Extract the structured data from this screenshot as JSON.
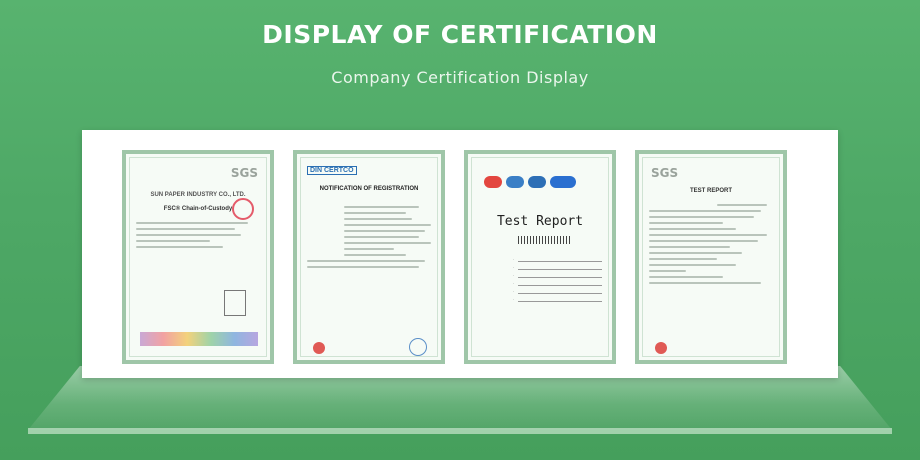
{
  "header": {
    "title": "DISPLAY OF CERTIFICATION",
    "subtitle": "Company Certification Display"
  },
  "certificates": [
    {
      "logo": "SGS",
      "company": "SUN PAPER INDUSTRY CO., LTD.",
      "heading": "FSC® Chain-of-Custody"
    },
    {
      "logo": "DIN CERTCO",
      "heading": "NOTIFICATION OF REGISTRATION"
    },
    {
      "heading": "Test Report"
    },
    {
      "logo": "SGS",
      "heading": "TEST REPORT"
    }
  ],
  "colors": {
    "background": "#4ea866",
    "board": "#ffffff",
    "certificate_border": "#9fc6a8"
  }
}
